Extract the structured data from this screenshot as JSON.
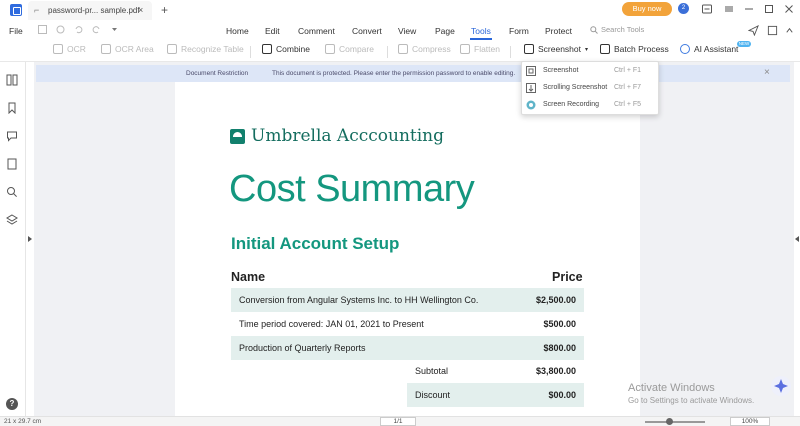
{
  "titlebar": {
    "tab_title": "password-pr... sample.pdf",
    "tab_close": "×",
    "add_tab": "+",
    "buy_now": "Buy now",
    "avatar_initial": "2"
  },
  "menubar": {
    "file": "File",
    "items": [
      "Home",
      "Edit",
      "Comment",
      "Convert",
      "View",
      "Page",
      "Tools",
      "Form",
      "Protect"
    ],
    "active": "Tools",
    "search_placeholder": "Search Tools"
  },
  "toolbar": {
    "tools": [
      {
        "label": "OCR",
        "enabled": false
      },
      {
        "label": "OCR Area",
        "enabled": false
      },
      {
        "label": "Recognize Table",
        "enabled": false
      },
      {
        "label": "Combine",
        "enabled": true
      },
      {
        "label": "Compare",
        "enabled": false
      },
      {
        "label": "Compress",
        "enabled": false
      },
      {
        "label": "Flatten",
        "enabled": false
      },
      {
        "label": "Screenshot",
        "enabled": true
      },
      {
        "label": "Batch Process",
        "enabled": true
      },
      {
        "label": "AI Assistant",
        "enabled": true
      }
    ],
    "new_badge": "NEW"
  },
  "restriction": {
    "label": "Document Restriction",
    "message": "This document is protected. Please enter the permission password to enable editing.",
    "close": "×"
  },
  "screenshot_menu": [
    {
      "label": "Screenshot",
      "shortcut": "Ctrl + F1",
      "icon": "screenshot-icon"
    },
    {
      "label": "Scrolling Screenshot",
      "shortcut": "Ctrl + F7",
      "icon": "scrolling-screenshot-icon"
    },
    {
      "label": "Screen Recording",
      "shortcut": "Ctrl + F5",
      "icon": "screen-recording-icon"
    }
  ],
  "document": {
    "logo_text": "Umbrella Acccounting",
    "title": "Cost Summary",
    "section_title": "Initial Account Setup",
    "col_name": "Name",
    "col_price": "Price",
    "rows": [
      {
        "desc": "Conversion from Angular Systems Inc. to HH Wellington Co.",
        "price": "$2,500.00"
      },
      {
        "desc": "Time period covered: JAN 01, 2021 to Present",
        "price": "$500.00"
      },
      {
        "desc": "Production of Quarterly Reports",
        "price": "$800.00"
      }
    ],
    "summary": [
      {
        "desc": "Subtotal",
        "price": "$3,800.00"
      },
      {
        "desc": "Discount",
        "price": "$00.00"
      }
    ]
  },
  "watermark": {
    "line1": "Activate Windows",
    "line2": "Go to Settings to activate Windows."
  },
  "statusbar": {
    "dimensions": "21 x 29.7 cm",
    "page_indicator": "1/1",
    "zoom": "100%"
  },
  "colors": {
    "accent": "#2a66d9",
    "brand_green": "#14977f",
    "buy_orange": "#f2a33a",
    "row_shade": "#e3efed"
  }
}
